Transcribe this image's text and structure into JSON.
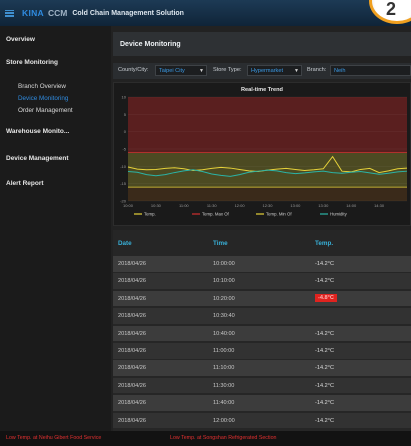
{
  "header": {
    "brand": "KINA",
    "brand_sub": "CCM",
    "title": "Cold Chain Management Solution",
    "badge": "2"
  },
  "sidebar": {
    "overview": "Overview",
    "store_monitoring": "Store Monitoring",
    "sub_items": [
      "Branch Overview",
      "Device Monitoring",
      "Order Management"
    ],
    "warehouse": "Warehouse Monito...",
    "device_management": "Device Management",
    "alert_report": "Alert Report"
  },
  "page": {
    "title": "Device Monitoring"
  },
  "filters": {
    "county_label": "County/City:",
    "county_value": "Taipei City",
    "store_type_label": "Store Type:",
    "store_type_value": "Hypermarket",
    "branch_label": "Branch:",
    "branch_value": "Neih"
  },
  "chart_data": {
    "type": "line",
    "title": "Real-time Trend",
    "x": [
      "10:00",
      "10:10",
      "10:20",
      "10:30",
      "10:40",
      "10:50",
      "11:00",
      "11:10",
      "11:20",
      "11:30",
      "11:40",
      "11:50",
      "12:00",
      "12:10",
      "12:20",
      "12:30",
      "12:40",
      "12:50",
      "13:00",
      "13:10",
      "13:20",
      "13:30",
      "13:40",
      "13:50",
      "14:00",
      "14:10",
      "14:20",
      "14:30",
      "14:40",
      "14:50",
      "15:00"
    ],
    "x_tick_labels": [
      "10:00",
      "10:30",
      "11:00",
      "11:30",
      "12:00",
      "12:30",
      "13:00",
      "13:30",
      "14:00",
      "14:30"
    ],
    "ylim": [
      -20,
      10
    ],
    "series": [
      {
        "name": "Temp.",
        "color": "#e6d23a",
        "values": [
          -10.2,
          -10.8,
          -11.0,
          -10.9,
          -10.6,
          -10.4,
          -10.7,
          -11.2,
          -11.0,
          -10.6,
          -10.3,
          -10.5,
          -10.9,
          -11.3,
          -11.5,
          -11.1,
          -10.8,
          -10.6,
          -10.9,
          -11.2,
          -11.0,
          -10.7,
          -7.2,
          -11.4,
          -11.6,
          -10.9,
          -10.6,
          -11.8,
          -11.3,
          -10.7,
          -10.5
        ]
      },
      {
        "name": "Humidity",
        "color": "#2bb3a6",
        "values": [
          -11.5,
          -11.7,
          -12.4,
          -12.7,
          -12.4,
          -11.8,
          -11.3,
          -11.0,
          -11.5,
          -12.2,
          -12.6,
          -12.9,
          -12.4,
          -11.7,
          -11.4,
          -11.1,
          -11.3,
          -11.8,
          -12.1,
          -11.9,
          -11.6,
          -11.4,
          -11.8,
          -12.0,
          -11.7,
          -11.5,
          -11.9,
          -12.3,
          -12.0,
          -11.6,
          -11.4
        ]
      },
      {
        "name": "Temp. Max Of",
        "color": "#d03030",
        "values": [
          -6,
          -6,
          -6,
          -6,
          -6,
          -6,
          -6,
          -6,
          -6,
          -6,
          -6,
          -6,
          -6,
          -6,
          -6,
          -6,
          -6,
          -6,
          -6,
          -6,
          -6,
          -6,
          -6,
          -6,
          -6,
          -6,
          -6,
          -6,
          -6,
          -6,
          -6
        ]
      },
      {
        "name": "Temp. Min Of",
        "color": "#e6d23a",
        "values": [
          -16,
          -16,
          -16,
          -16,
          -16,
          -16,
          -16,
          -16,
          -16,
          -16,
          -16,
          -16,
          -16,
          -16,
          -16,
          -16,
          -16,
          -16,
          -16,
          -16,
          -16,
          -16,
          -16,
          -16,
          -16,
          -16,
          -16,
          -16,
          -16,
          -16,
          -16
        ]
      }
    ],
    "bands": [
      {
        "from": -6,
        "to": 10,
        "color": "#5a1f1f"
      },
      {
        "from": -16,
        "to": -6,
        "color": "#4c4a22"
      },
      {
        "from": -20,
        "to": -16,
        "color": "#3a2a1a"
      }
    ],
    "legend": [
      "Temp.",
      "Temp. Max Of",
      "Temp. Min Of",
      "Humidity"
    ]
  },
  "table": {
    "headers": [
      "Date",
      "Time",
      "Temp."
    ],
    "rows": [
      {
        "date": "2018/04/26",
        "time": "10:00:00",
        "temp": "-14.2°C",
        "alert": false
      },
      {
        "date": "2018/04/26",
        "time": "10:10:00",
        "temp": "-14.2°C",
        "alert": false
      },
      {
        "date": "2018/04/26",
        "time": "10:20:00",
        "temp": "-4.8°C",
        "alert": true
      },
      {
        "date": "2018/04/26",
        "time": "10:30:40",
        "temp": "",
        "alert": false
      },
      {
        "date": "2018/04/26",
        "time": "10:40:00",
        "temp": "-14.2°C",
        "alert": false
      },
      {
        "date": "2018/04/26",
        "time": "11:00:00",
        "temp": "-14.2°C",
        "alert": false
      },
      {
        "date": "2018/04/26",
        "time": "11:10:00",
        "temp": "-14.2°C",
        "alert": false
      },
      {
        "date": "2018/04/26",
        "time": "11:30:00",
        "temp": "-14.2°C",
        "alert": false
      },
      {
        "date": "2018/04/26",
        "time": "11:40:00",
        "temp": "-14.2°C",
        "alert": false
      },
      {
        "date": "2018/04/26",
        "time": "12:00:00",
        "temp": "-14.2°C",
        "alert": false
      }
    ]
  },
  "status": {
    "alarm_left": "Low Temp. at Neihu Gibert Food Service",
    "alarm_right": "Low Temp. at Songshan Refrigerated Section"
  }
}
